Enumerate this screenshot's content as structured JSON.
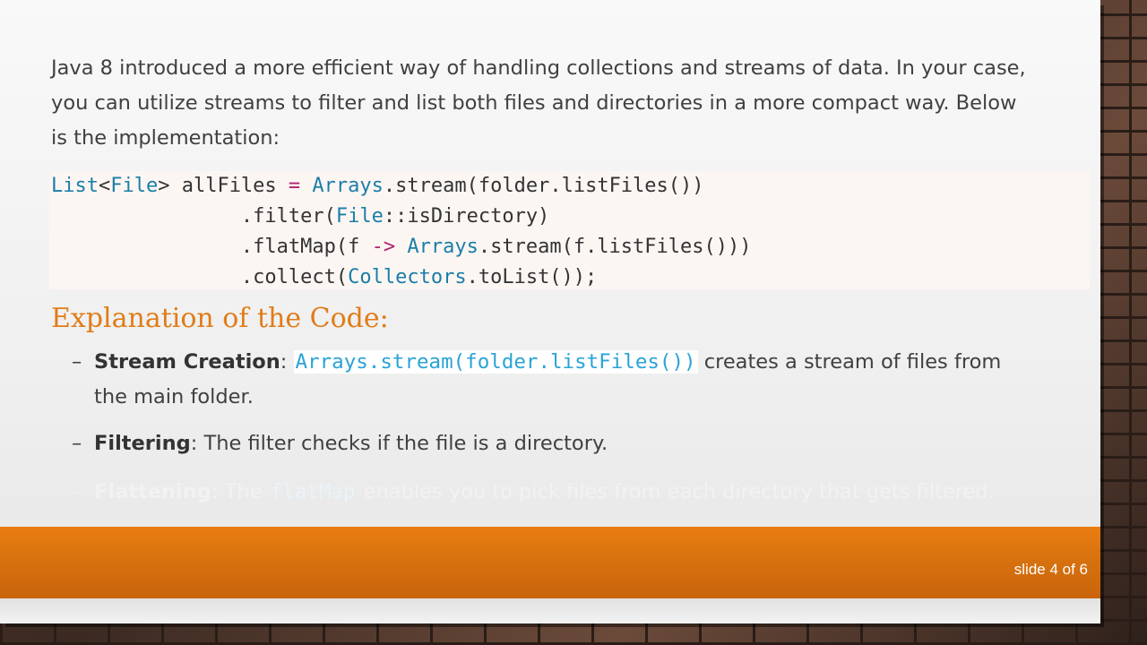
{
  "intro": {
    "line1": "Java 8 introduced a more efficient way of handling collections and streams of data. In your case,",
    "line2": "you can utilize streams to filter and list both files and directories in a more compact way. Below",
    "line3": "is the implementation:"
  },
  "code": {
    "l1_a": "List",
    "l1_b": "<",
    "l1_c": "File",
    "l1_d": "> allFiles ",
    "l1_e": "=",
    "l1_f": " ",
    "l1_g": "Arrays",
    "l1_h": ".stream(folder.listFiles())",
    "l2_a": "                .filter(",
    "l2_b": "File",
    "l2_c": "::isDirectory)",
    "l3_a": "                .flatMap(f ",
    "l3_b": "->",
    "l3_c": " ",
    "l3_d": "Arrays",
    "l3_e": ".stream(f.listFiles()))",
    "l4_a": "                .collect(",
    "l4_b": "Collectors",
    "l4_c": ".toList());"
  },
  "heading": "Explanation of the Code:",
  "bullets": [
    {
      "dash": "–",
      "title": "Stream Creation",
      "sep": ":",
      "code": "Arrays.stream(folder.listFiles())",
      "rest1": " creates a stream of files from",
      "rest2": "the main folder."
    },
    {
      "dash": "–",
      "title": "Filtering",
      "rest": ": The filter checks if the file is a directory."
    },
    {
      "dash": "–",
      "title": "Flattening",
      "sep": ": The ",
      "code": "flatMap",
      "rest": " enables you to pick files from each directory that gets filtered."
    }
  ],
  "footer": {
    "slide_label": "slide 4 of 6"
  },
  "colors": {
    "accent": "#e07c19",
    "footer": "#e07a12",
    "code_keyword": "#1a7ea8",
    "code_operator": "#b1216b"
  }
}
